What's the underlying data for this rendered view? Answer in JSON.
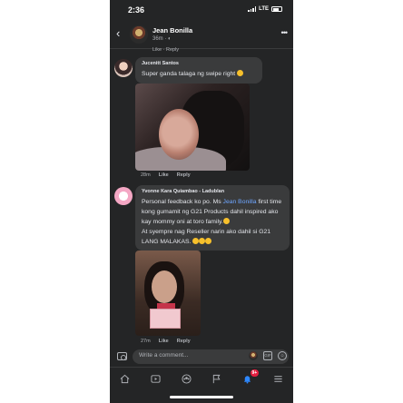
{
  "status": {
    "time": "2:36",
    "network": "LTE"
  },
  "header": {
    "name": "Jean Bonilla",
    "time": "36m"
  },
  "prev_actions": "Like · Reply",
  "comments": [
    {
      "author": "Jucenitt Santos",
      "text": "Super ganda talaga ng swipe right",
      "time": "28m",
      "like": "Like",
      "reply": "Reply"
    },
    {
      "author": "Yvonne Kara Quiambao - Ladublan",
      "text_before": "Personal feedback ko po. Ms ",
      "mention": "Jean Bonilla",
      "text_after": " first time kong gumamit ng G21 Products dahil inspired ako kay mommy oni at toro family.",
      "text_line2": "At syempre nag Reseller narin ako dahil si G21 LANG MALAKAS.",
      "time": "27m",
      "like": "Like",
      "reply": "Reply"
    }
  ],
  "composer": {
    "placeholder": "Write a comment...",
    "gif_label": "GIF"
  },
  "tabs": [
    {
      "icon": "home-icon"
    },
    {
      "icon": "video-icon"
    },
    {
      "icon": "groups-icon"
    },
    {
      "icon": "flag-icon"
    },
    {
      "icon": "bell-icon",
      "badge": "9+"
    },
    {
      "icon": "menu-icon"
    }
  ],
  "colors": {
    "background": "#242526",
    "bubble": "#3a3b3c",
    "accent": "#2d88ff",
    "badge": "#e41e3f",
    "mention": "#6ea6ff"
  }
}
